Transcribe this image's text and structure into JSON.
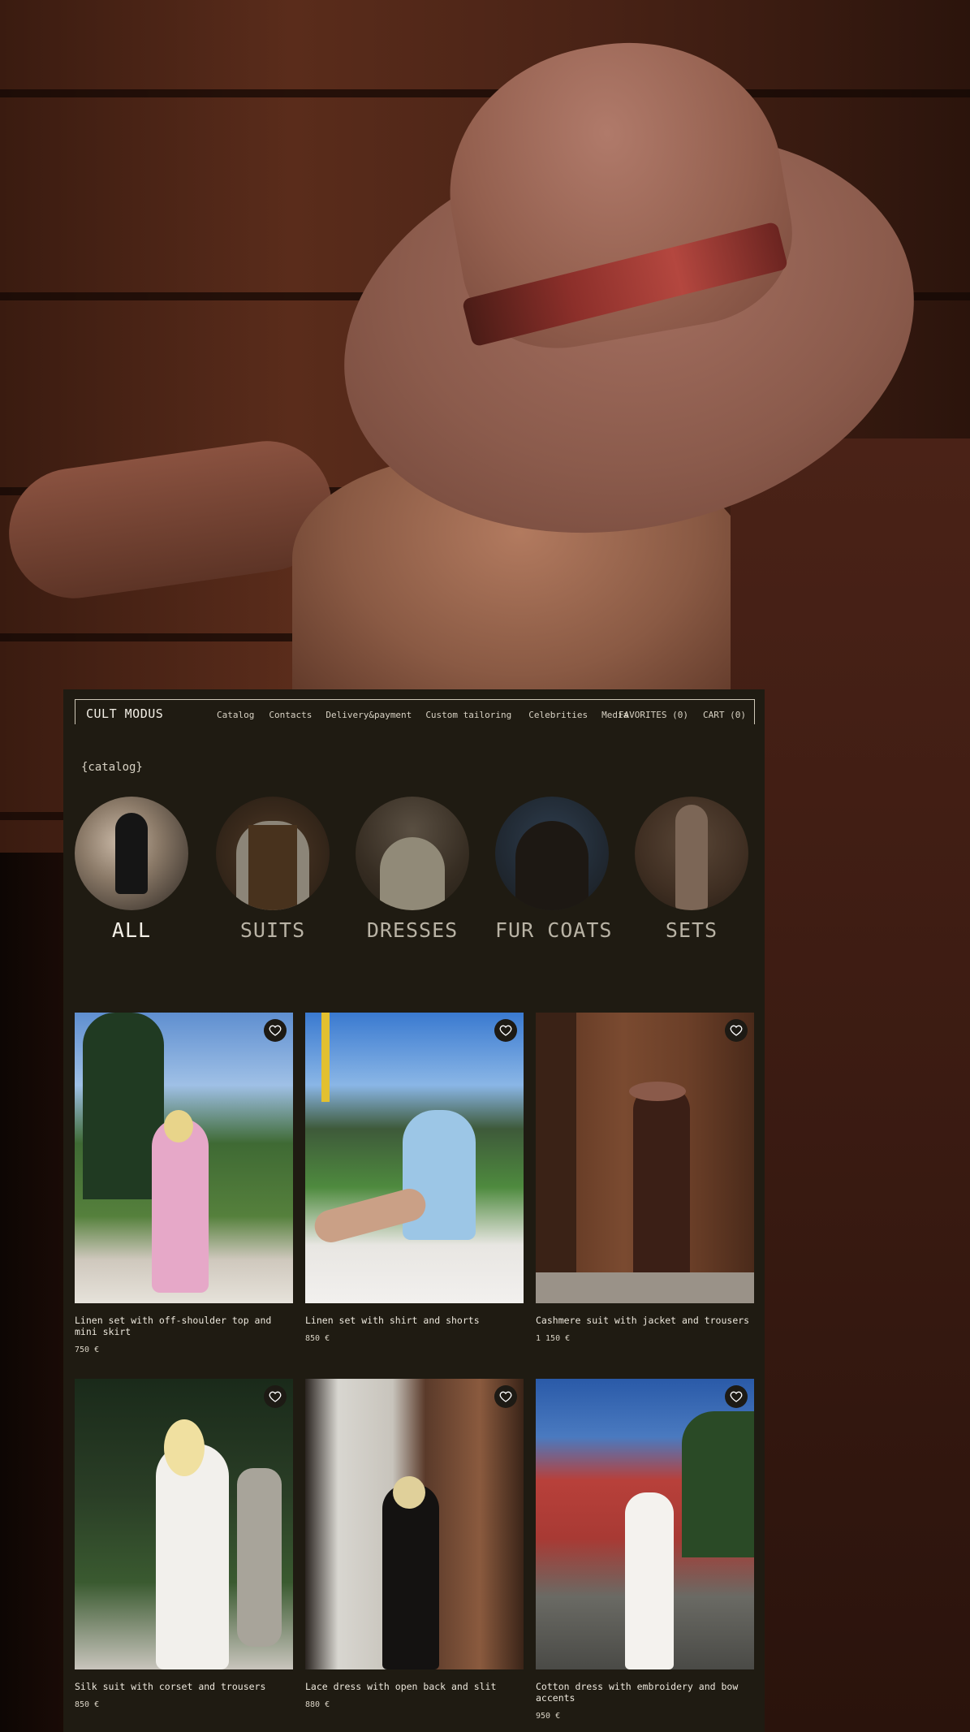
{
  "brand": {
    "name": "CULT MODUS"
  },
  "nav": {
    "links": [
      "Catalog",
      "Contacts",
      "Delivery&payment",
      "Custom tailoring",
      "Celebrities",
      "Media"
    ],
    "favorites": "FAVORITES (0)",
    "cart": "CART (0)"
  },
  "catalog": {
    "label": "{catalog}",
    "categories": [
      {
        "label": "ALL",
        "active": true
      },
      {
        "label": "SUITS",
        "active": false
      },
      {
        "label": "DRESSES",
        "active": false
      },
      {
        "label": "FUR COATS",
        "active": false
      },
      {
        "label": "SETS",
        "active": false
      }
    ]
  },
  "products": [
    {
      "name": "Linen set with off-shoulder top and mini skirt",
      "price": "750 €"
    },
    {
      "name": "Linen set with shirt and shorts",
      "price": "850 €"
    },
    {
      "name": "Cashmere suit with jacket and trousers",
      "price": "1 150 €"
    },
    {
      "name": "Silk suit with corset and trousers",
      "price": "850 €"
    },
    {
      "name": "Lace dress with open back and slit",
      "price": "880 €"
    },
    {
      "name": "Cotton dress with embroidery and bow accents",
      "price": "950 €"
    }
  ],
  "colors": {
    "panel": "#1f1b12",
    "text": "#ece7dc",
    "muted": "#b9b3a5"
  },
  "icons": {
    "favorite": "heart-icon"
  }
}
